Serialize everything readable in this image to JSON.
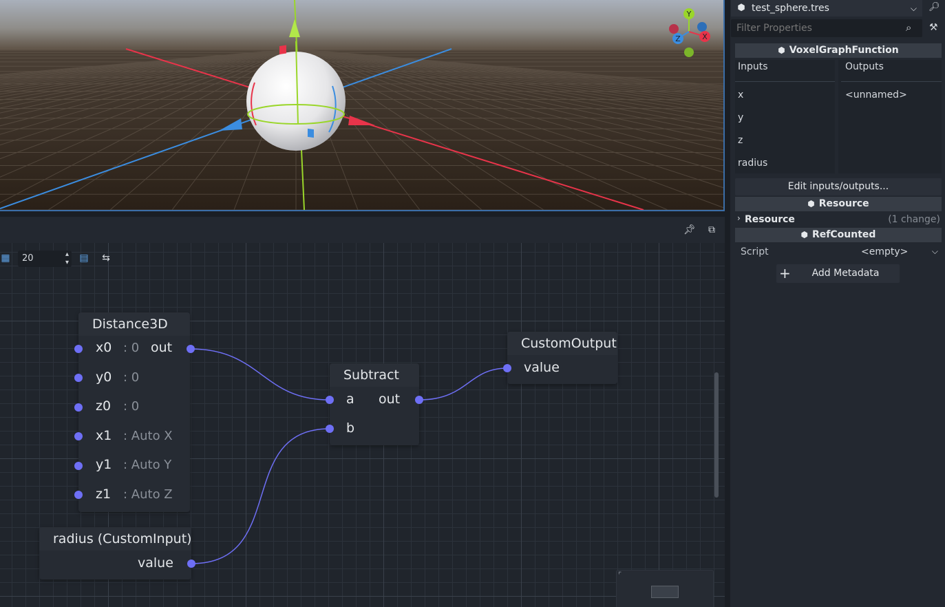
{
  "inspector": {
    "resource_name": "test_sphere.tres",
    "filter_placeholder": "Filter Properties",
    "sections": {
      "voxel_graph_function": "VoxelGraphFunction",
      "resource": "Resource",
      "refcounted": "RefCounted"
    },
    "inputs_header": "Inputs",
    "outputs_header": "Outputs",
    "inputs": [
      "x",
      "y",
      "z",
      "radius"
    ],
    "outputs": [
      "<unnamed>"
    ],
    "edit_io_button": "Edit inputs/outputs...",
    "resource_group_label": "Resource",
    "resource_group_changes": "(1 change)",
    "script_label": "Script",
    "script_value": "<empty>",
    "add_metadata_button": "Add Metadata"
  },
  "graph": {
    "snap_value": "20",
    "nodes": {
      "distance3d": {
        "title": "Distance3D",
        "ports": [
          {
            "name": "x0",
            "default": ": 0"
          },
          {
            "name": "y0",
            "default": ": 0"
          },
          {
            "name": "z0",
            "default": ": 0"
          },
          {
            "name": "x1",
            "default": ": Auto X"
          },
          {
            "name": "y1",
            "default": ": Auto Y"
          },
          {
            "name": "z1",
            "default": ": Auto Z"
          }
        ],
        "output": "out"
      },
      "subtract": {
        "title": "Subtract",
        "input_a": "a",
        "input_b": "b",
        "output": "out"
      },
      "custom_output": {
        "title": "CustomOutput",
        "input": "value"
      },
      "custom_input": {
        "title": "radius (CustomInput)",
        "output": "value"
      }
    }
  },
  "viewport": {
    "gizmo_labels": {
      "y": "Y",
      "x": "X",
      "z": "Z"
    },
    "colors": {
      "x_axis": "#e8344a",
      "y_axis": "#9ad62a",
      "z_axis": "#3b8de0",
      "port": "#6e6ff5",
      "wire": "#6e6ff5"
    }
  }
}
